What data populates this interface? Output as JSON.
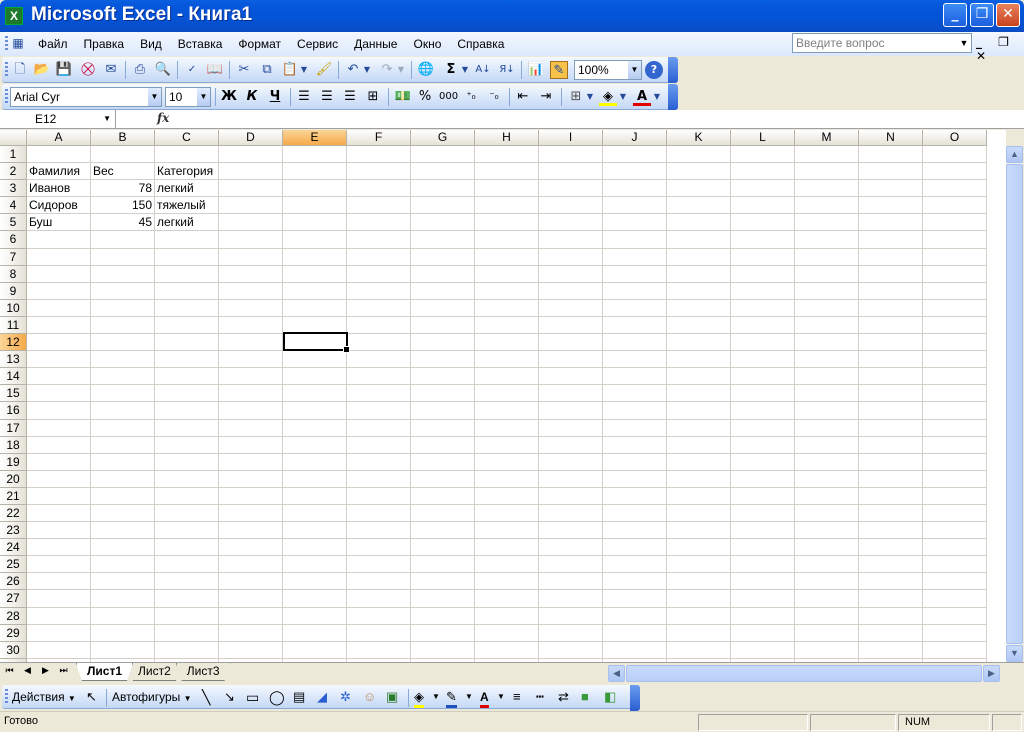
{
  "window": {
    "title": "Microsoft Excel - Книга1",
    "app_icon": "excel-icon",
    "min": "_",
    "max": "❐",
    "close": "✕"
  },
  "menu": {
    "items": [
      "Файл",
      "Правка",
      "Вид",
      "Вставка",
      "Формат",
      "Сервис",
      "Данные",
      "Окно",
      "Справка"
    ],
    "ask_placeholder": "Введите вопрос",
    "mdi_buttons": "_ ❐ ✕"
  },
  "toolbar": {
    "zoom": "100%",
    "font": "Arial Cyr",
    "size": "10",
    "bold": "Ж",
    "italic": "К",
    "underline": "Ч",
    "percent": "%",
    "thousands": "000"
  },
  "formula_bar": {
    "name_box": "E12",
    "fx": "fx",
    "formula": ""
  },
  "grid": {
    "columns": [
      "A",
      "B",
      "C",
      "D",
      "E",
      "F",
      "G",
      "H",
      "I",
      "J",
      "K",
      "L",
      "M",
      "N",
      "O"
    ],
    "selected_column": "E",
    "selected_row": 12,
    "row_count": 31,
    "cells": {
      "A2": "Фамилия",
      "B2": "Вес",
      "C2": "Категория",
      "A3": "Иванов",
      "B3": "78",
      "C3": "легкий",
      "A4": "Сидоров",
      "B4": "150",
      "C4": "тяжелый",
      "A5": "Буш",
      "B5": "45",
      "C5": "легкий"
    }
  },
  "sheets": {
    "tabs": [
      "Лист1",
      "Лист2",
      "Лист3"
    ],
    "active": "Лист1"
  },
  "drawing": {
    "actions": "Действия",
    "autoshapes": "Автофигуры"
  },
  "status": {
    "text": "Готово",
    "num": "NUM"
  }
}
